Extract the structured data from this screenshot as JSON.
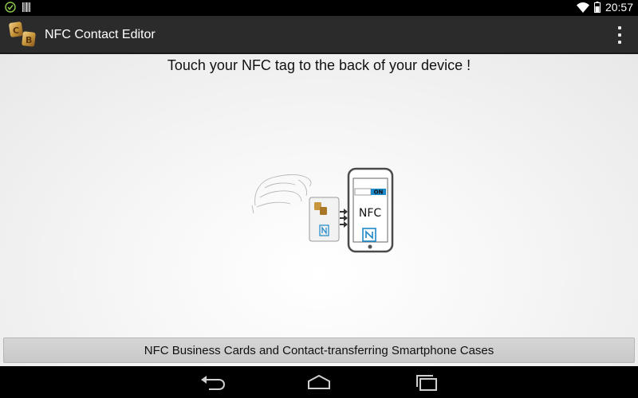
{
  "status_bar": {
    "time": "20:57",
    "icons": [
      "check-circle-icon",
      "barcode-icon",
      "wifi-icon",
      "battery-icon"
    ]
  },
  "action_bar": {
    "title": "NFC Contact Editor",
    "icon": "app-logo-icon",
    "overflow_icon": "overflow-menu-icon"
  },
  "main": {
    "instruction": "Touch your NFC tag to the back of your device !",
    "illustration": {
      "phone_toggle": "ON",
      "phone_label": "NFC"
    },
    "promo_link": "NFC Business Cards and Contact-transferring Smartphone Cases"
  },
  "nav_bar": {
    "buttons": [
      "back-icon",
      "home-icon",
      "recent-apps-icon"
    ]
  },
  "colors": {
    "action_bar": "#2b2b2b",
    "accent_blue": "#1e88c8",
    "gold": "#c8963c"
  }
}
